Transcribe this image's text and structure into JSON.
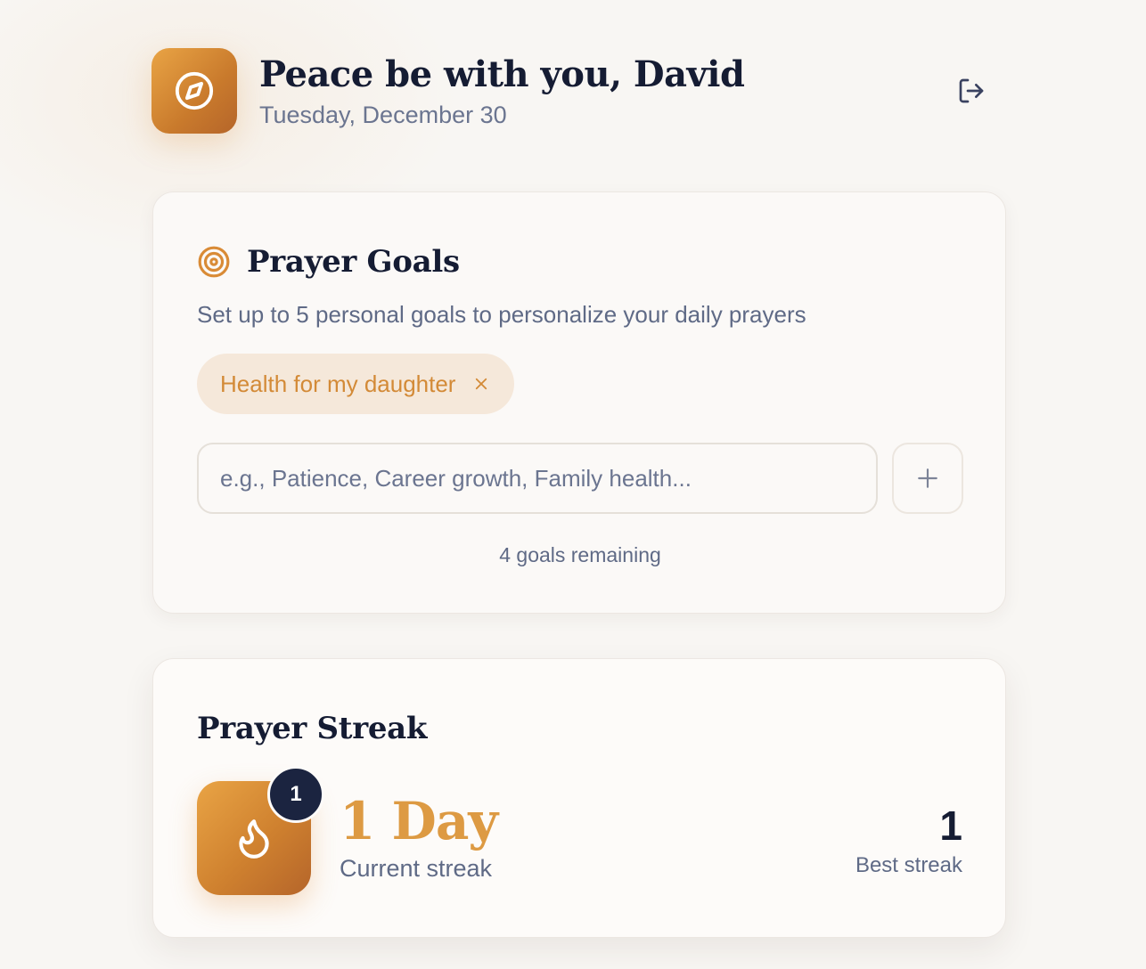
{
  "header": {
    "greeting": "Peace be with you, David",
    "date": "Tuesday, December 30",
    "app_icon": "compass-icon",
    "logout_icon": "logout-icon"
  },
  "prayer_goals": {
    "title": "Prayer Goals",
    "title_icon": "target-icon",
    "subtitle": "Set up to 5 personal goals to personalize your daily prayers",
    "goals": [
      {
        "label": "Health for my daughter",
        "remove_icon": "close-icon"
      }
    ],
    "input": {
      "value": "",
      "placeholder": "e.g., Patience, Career growth, Family health..."
    },
    "add_icon": "plus-icon",
    "remaining_text": "4 goals remaining"
  },
  "prayer_streak": {
    "title": "Prayer Streak",
    "icon": "flame-icon",
    "badge": "1",
    "current_value": "1 Day",
    "current_label": "Current streak",
    "best_value": "1",
    "best_label": "Best streak"
  },
  "colors": {
    "accent": "#dd9a43",
    "accent_dark": "#b5652a",
    "navy": "#1b2440",
    "chip_bg": "#f5e8da",
    "muted_text": "#5f6a86"
  }
}
